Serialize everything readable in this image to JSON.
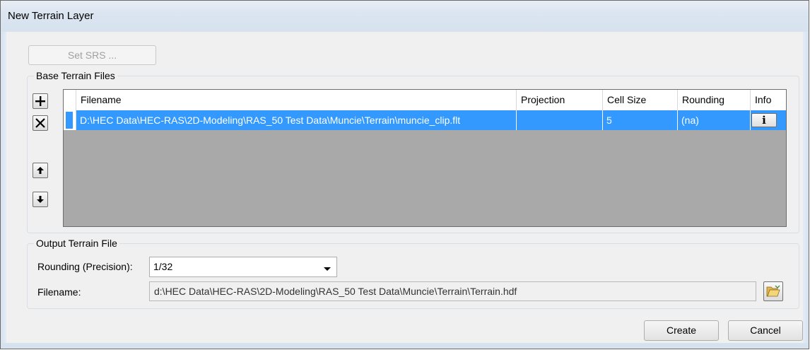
{
  "window": {
    "title": "New Terrain Layer"
  },
  "toolbar": {
    "set_srs_label": "Set SRS ..."
  },
  "base_terrain": {
    "group_label": "Base Terrain Files",
    "columns": [
      "Filename",
      "Projection",
      "Cell Size",
      "Rounding",
      "Info"
    ],
    "rows": [
      {
        "filename": "D:\\HEC Data\\HEC-RAS\\2D-Modeling\\RAS_50 Test Data\\Muncie\\Terrain\\muncie_clip.flt",
        "projection": "",
        "cell_size": "5",
        "rounding": "(na)",
        "info_icon": "info-icon"
      }
    ],
    "buttons": {
      "add_icon": "plus-icon",
      "remove_icon": "x-icon",
      "up_icon": "arrow-up-icon",
      "down_icon": "arrow-down-icon"
    }
  },
  "output_terrain": {
    "group_label": "Output Terrain File",
    "rounding_label": "Rounding (Precision):",
    "rounding_value": "1/32",
    "filename_label": "Filename:",
    "filename_value": "d:\\HEC Data\\HEC-RAS\\2D-Modeling\\RAS_50 Test Data\\Muncie\\Terrain\\Terrain.hdf",
    "browse_icon": "open-folder-icon"
  },
  "footer": {
    "create_label": "Create",
    "cancel_label": "Cancel"
  },
  "colors": {
    "selection": "#3399ff",
    "grid_background": "#a9a9a9",
    "titlebar": "#dbe5f1"
  }
}
